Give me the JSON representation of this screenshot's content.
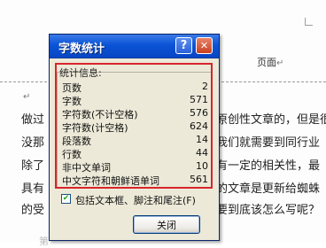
{
  "document": {
    "header_label": "页面",
    "lines_right": [
      "原创性文章的，但是很",
      "我们就需要到同行业",
      "有一定的相关性，最",
      "的文章是更新给蜘蛛",
      "要到底该怎么写呢？"
    ],
    "lines_left": [
      "做过",
      "没那",
      "除了",
      "具有",
      "的受"
    ],
    "bottom_faint": "第"
  },
  "dialog": {
    "title": "字数统计",
    "help_glyph": "?",
    "close_glyph": "✕",
    "group_label": "统计信息:",
    "stats": [
      {
        "label": "页数",
        "value": "2"
      },
      {
        "label": "字数",
        "value": "571"
      },
      {
        "label": "字符数(不计空格)",
        "value": "576"
      },
      {
        "label": "字符数(计空格)",
        "value": "624"
      },
      {
        "label": "段落数",
        "value": "14"
      },
      {
        "label": "行数",
        "value": "44"
      },
      {
        "label": "非中文单词",
        "value": "10"
      },
      {
        "label": "中文字符和朝鲜语单词",
        "value": "561"
      }
    ],
    "checkbox_label": "包括文本框、脚注和尾注(F)",
    "checkbox_checked": true,
    "close_button_label": "关闭"
  },
  "colors": {
    "title_bar": "#0a54d6",
    "highlight": "#d7262b",
    "dialog_bg": "#ece9d8"
  }
}
